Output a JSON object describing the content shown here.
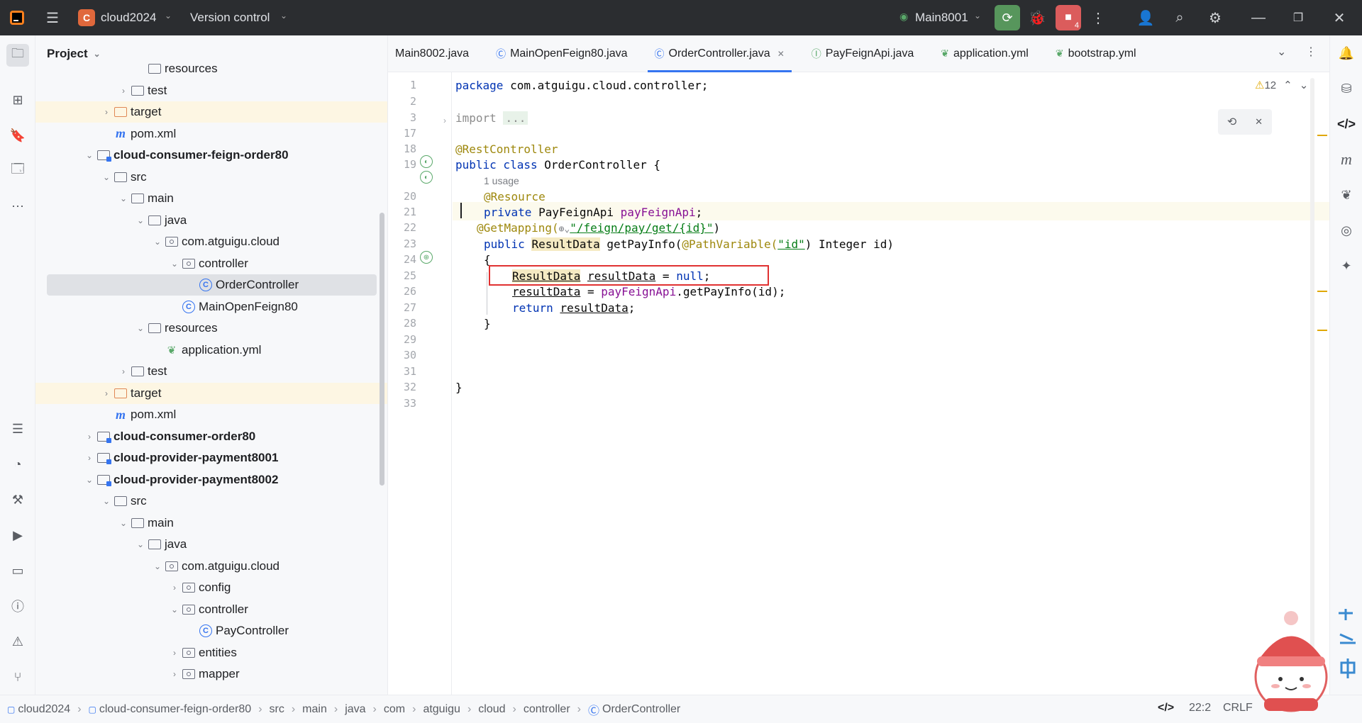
{
  "titlebar": {
    "project_badge": "C",
    "project_name": "cloud2024",
    "vcs_label": "Version control",
    "run_config": "Main8001",
    "stop_count": "4"
  },
  "project_panel": {
    "title": "Project",
    "tree": [
      {
        "label": "resources",
        "indent": 5,
        "icon": "folder-res",
        "arrow": "",
        "bold": false,
        "hl": false
      },
      {
        "label": "test",
        "indent": 4,
        "icon": "folder",
        "arrow": ">",
        "bold": false,
        "hl": false
      },
      {
        "label": "target",
        "indent": 3,
        "icon": "folder-orange",
        "arrow": ">",
        "bold": false,
        "hl": true
      },
      {
        "label": "pom.xml",
        "indent": 3,
        "icon": "maven",
        "arrow": "",
        "bold": false,
        "hl": false
      },
      {
        "label": "cloud-consumer-feign-order80",
        "indent": 2,
        "icon": "module",
        "arrow": "v",
        "bold": true,
        "hl": false
      },
      {
        "label": "src",
        "indent": 3,
        "icon": "folder",
        "arrow": "v",
        "bold": false,
        "hl": false
      },
      {
        "label": "main",
        "indent": 4,
        "icon": "folder",
        "arrow": "v",
        "bold": false,
        "hl": false
      },
      {
        "label": "java",
        "indent": 5,
        "icon": "folder-src",
        "arrow": "v",
        "bold": false,
        "hl": false
      },
      {
        "label": "com.atguigu.cloud",
        "indent": 6,
        "icon": "package",
        "arrow": "v",
        "bold": false,
        "hl": false
      },
      {
        "label": "controller",
        "indent": 7,
        "icon": "package",
        "arrow": "v",
        "bold": false,
        "hl": false
      },
      {
        "label": "OrderController",
        "indent": 8,
        "icon": "class",
        "arrow": "",
        "bold": false,
        "hl": false,
        "sel": true
      },
      {
        "label": "MainOpenFeign80",
        "indent": 7,
        "icon": "class",
        "arrow": "",
        "bold": false,
        "hl": false
      },
      {
        "label": "resources",
        "indent": 5,
        "icon": "folder-res",
        "arrow": "v",
        "bold": false,
        "hl": false
      },
      {
        "label": "application.yml",
        "indent": 6,
        "icon": "yml",
        "arrow": "",
        "bold": false,
        "hl": false
      },
      {
        "label": "test",
        "indent": 4,
        "icon": "folder",
        "arrow": ">",
        "bold": false,
        "hl": false
      },
      {
        "label": "target",
        "indent": 3,
        "icon": "folder-orange",
        "arrow": ">",
        "bold": false,
        "hl": true
      },
      {
        "label": "pom.xml",
        "indent": 3,
        "icon": "maven",
        "arrow": "",
        "bold": false,
        "hl": false
      },
      {
        "label": "cloud-consumer-order80",
        "indent": 2,
        "icon": "module",
        "arrow": ">",
        "bold": true,
        "hl": false
      },
      {
        "label": "cloud-provider-payment8001",
        "indent": 2,
        "icon": "module",
        "arrow": ">",
        "bold": true,
        "hl": false
      },
      {
        "label": "cloud-provider-payment8002",
        "indent": 2,
        "icon": "module",
        "arrow": "v",
        "bold": true,
        "hl": false
      },
      {
        "label": "src",
        "indent": 3,
        "icon": "folder",
        "arrow": "v",
        "bold": false,
        "hl": false
      },
      {
        "label": "main",
        "indent": 4,
        "icon": "folder",
        "arrow": "v",
        "bold": false,
        "hl": false
      },
      {
        "label": "java",
        "indent": 5,
        "icon": "folder-src",
        "arrow": "v",
        "bold": false,
        "hl": false
      },
      {
        "label": "com.atguigu.cloud",
        "indent": 6,
        "icon": "package",
        "arrow": "v",
        "bold": false,
        "hl": false
      },
      {
        "label": "config",
        "indent": 7,
        "icon": "package",
        "arrow": ">",
        "bold": false,
        "hl": false
      },
      {
        "label": "controller",
        "indent": 7,
        "icon": "package",
        "arrow": "v",
        "bold": false,
        "hl": false
      },
      {
        "label": "PayController",
        "indent": 8,
        "icon": "class",
        "arrow": "",
        "bold": false,
        "hl": false
      },
      {
        "label": "entities",
        "indent": 7,
        "icon": "package",
        "arrow": ">",
        "bold": false,
        "hl": false
      },
      {
        "label": "mapper",
        "indent": 7,
        "icon": "package",
        "arrow": ">",
        "bold": false,
        "hl": false
      }
    ]
  },
  "tabs": [
    {
      "label": "Main8002.java",
      "icon": "",
      "active": false,
      "closable": false
    },
    {
      "label": "MainOpenFeign80.java",
      "icon": "class-run",
      "active": false,
      "closable": false
    },
    {
      "label": "OrderController.java",
      "icon": "class",
      "active": true,
      "closable": true
    },
    {
      "label": "PayFeignApi.java",
      "icon": "interface",
      "active": false,
      "closable": false
    },
    {
      "label": "application.yml",
      "icon": "yml",
      "active": false,
      "closable": false
    },
    {
      "label": "bootstrap.yml",
      "icon": "yml",
      "active": false,
      "closable": false
    }
  ],
  "editor": {
    "warnings_count": "12",
    "usage_hint": "1 usage",
    "line_numbers": [
      "1",
      "2",
      "3",
      "17",
      "18",
      "19",
      "20",
      "21",
      "22",
      "23",
      "24",
      "25",
      "26",
      "27",
      "28",
      "29",
      "30",
      "31",
      "32",
      "33"
    ],
    "code": {
      "l1_kw": "package",
      "l1_rest": " com.atguigu.cloud.controller;",
      "l3_kw": "import",
      "l3_fold": "...",
      "l18": "@RestController",
      "l19_kw": "public class",
      "l19_rest": " OrderController {",
      "l20": "@Resource",
      "l21_kw": "private",
      "l21_type": " PayFeignApi ",
      "l21_field": "payFeignApi",
      "l21_end": ";",
      "l22_ann": "@GetMapping(",
      "l22_str": "\"/feign/pay/get/{id}\"",
      "l22_end": ")",
      "l23_kw": "public",
      "l23_type": "ResultData",
      "l23_mid": " getPayInfo(",
      "l23_ann": "@PathVariable(",
      "l23_str": "\"id\"",
      "l23_end": ") Integer id)",
      "l24": "{",
      "l25_type": "ResultData",
      "l25_var": "resultData",
      "l25_eq": " = ",
      "l25_null": "null",
      "l25_end": ";",
      "l26_var": "resultData",
      "l26_eq": " = ",
      "l26_field": "payFeignApi",
      "l26_end": ".getPayInfo(id);",
      "l27_kw": "return",
      "l27_var": "resultData",
      "l27_end": ";",
      "l28": "}",
      "l32": "}"
    }
  },
  "statusbar": {
    "breadcrumbs": [
      "cloud2024",
      "cloud-consumer-feign-order80",
      "src",
      "main",
      "java",
      "com",
      "atguigu",
      "cloud",
      "controller",
      "OrderController"
    ],
    "position": "22:2",
    "line_sep": "CRLF"
  },
  "colors": {
    "accent": "#3574f0",
    "highlight_box": "#e03131",
    "run_green": "#57965c",
    "stop_red": "#db5c5c"
  }
}
